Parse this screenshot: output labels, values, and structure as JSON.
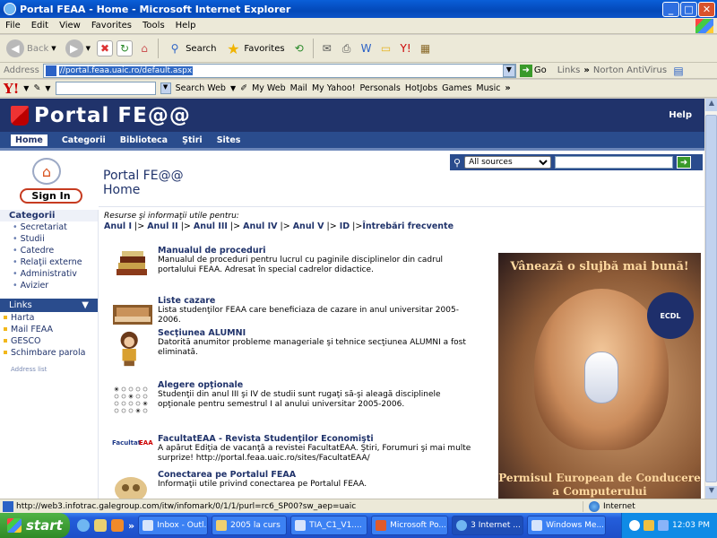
{
  "window": {
    "title": "Portal FEAA - Home - Microsoft Internet Explorer"
  },
  "menu": [
    "File",
    "Edit",
    "View",
    "Favorites",
    "Tools",
    "Help"
  ],
  "toolbar": {
    "back": "Back",
    "search": "Search",
    "favorites": "Favorites"
  },
  "address": {
    "label": "Address",
    "url": "//portal.feaa.uaic.ro/default.aspx",
    "go": "Go",
    "links": "Links",
    "norton": "Norton AntiVirus"
  },
  "yahoo": {
    "search_web": "Search Web",
    "items": [
      "My Web",
      "Mail",
      "My Yahoo!",
      "Personals",
      "HotJobs",
      "Games",
      "Music"
    ]
  },
  "portal": {
    "title": "Portal FE@@",
    "help": "Help",
    "nav": [
      "Home",
      "Categorii",
      "Biblioteca",
      "Ştiri",
      "Sites"
    ],
    "sign_in": "Sign In",
    "page_title_1": "Portal FE@@",
    "page_title_2": "Home",
    "search_scope": "All sources",
    "resurse": "Resurse şi informaţii utile pentru:",
    "years": [
      "Anul I",
      "Anul II",
      "Anul III",
      "Anul IV",
      "Anul V",
      "ID",
      "Întrebări frecvente"
    ]
  },
  "leftnav": {
    "categorii_title": "Categorii",
    "categorii": [
      "Secretariat",
      "Studii",
      "Catedre",
      "Relaţii externe",
      "Administrativ",
      "Avizier"
    ],
    "links_title": "Links",
    "links": [
      "Harta",
      "Mail FEAA",
      "GESCO",
      "Schimbare parola"
    ],
    "small": "Address list"
  },
  "items": [
    {
      "title": "Manualul de proceduri",
      "desc": "Manualul de proceduri pentru lucrul cu paginile disciplinelor din cadrul portalului FEAA. Adresat în special cadrelor didactice."
    },
    {
      "title": "Liste cazare",
      "desc": "Lista studenţilor FEAA care beneficiaza de cazare in anul universitar 2005-2006."
    },
    {
      "title": "Secţiunea ALUMNI",
      "desc": "Datorită anumitor probleme manageriale şi tehnice secţiunea ALUMNI a fost eliminată."
    },
    {
      "title": "Alegere opţionale",
      "desc": "Studenţii din anul III şi IV de studii sunt rugaţi să-şi aleagă disciplinele opţionale pentru semestrul I al anului universitar 2005-2006."
    },
    {
      "title": "FacultatEAA - Revista Studenţilor Economişti",
      "desc": "A apărut Ediţia de vacanţă a revistei FacultatEAA. Ştiri, Forumuri şi mai multe surprize! http://portal.feaa.uaic.ro/sites/FacultatEAA/"
    },
    {
      "title": "Conectarea pe Portalul FEAA",
      "desc": "Informaţii utile privind conectarea pe Portalul FEAA."
    }
  ],
  "ad": {
    "top": "Vânează o slujbă mai bună!",
    "bottom": "Permisul European de Conducere a Computerului",
    "badge": "ECDL"
  },
  "status": {
    "url": "http://web3.infotrac.galegroup.com/itw/infomark/0/1/1/purl=rc6_SP00?sw_aep=uaic",
    "zone": "Internet"
  },
  "taskbar": {
    "start": "start",
    "tasks": [
      "Inbox - Outl...",
      "2005 la curs",
      "TIA_C1_V1....",
      "Microsoft Po...",
      "3 Internet ...",
      "Windows Me..."
    ],
    "clock": "12:03 PM"
  }
}
